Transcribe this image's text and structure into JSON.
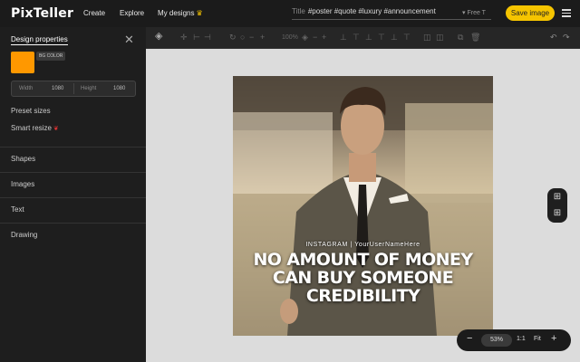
{
  "header": {
    "logo": "PixTeller",
    "nav": [
      "Create",
      "Explore",
      "My designs"
    ],
    "crown_glyph": "♛",
    "title_label": "Title",
    "title_value": "#poster #quote #luxury #announcement",
    "font_hint": "▾ Free T",
    "save_label": "Save image",
    "accent": "#f5c400"
  },
  "panel": {
    "heading": "Design properties",
    "bg_color_label": "BG COLOR",
    "bg_color": "#ff9800",
    "width_label": "Width",
    "width_value": "1080",
    "height_label": "Height",
    "height_value": "1080",
    "preset_sizes": "Preset sizes",
    "smart_resize": "Smart resize",
    "sections": [
      "Shapes",
      "Images",
      "Text",
      "Drawing"
    ]
  },
  "toolbar": {
    "zoom_text": "100%"
  },
  "canvas": {
    "brand_line": "INSTAGRAM | YourUserNameHere",
    "quote_lines": [
      "NO AMOUNT OF MONEY",
      "CAN BUY SOMEONE",
      "CREDIBILITY"
    ]
  },
  "zoom": {
    "minus": "−",
    "level": "53%",
    "one_to_one": "1:1",
    "fit": "Fit",
    "plus": "+"
  }
}
